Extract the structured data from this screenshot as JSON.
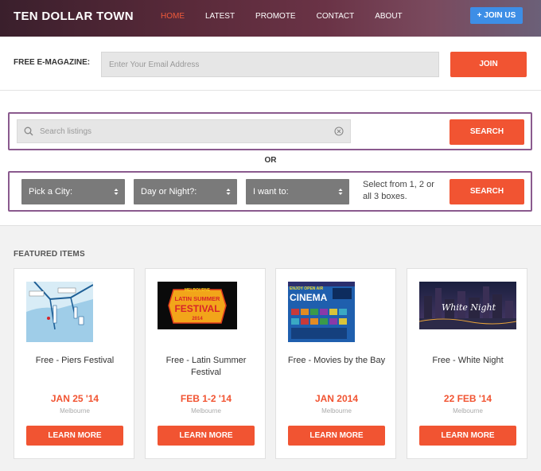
{
  "header": {
    "logo": "TEN DOLLAR TOWN",
    "nav": [
      {
        "label": "HOME",
        "active": true
      },
      {
        "label": "LATEST",
        "active": false
      },
      {
        "label": "PROMOTE",
        "active": false
      },
      {
        "label": "CONTACT",
        "active": false
      },
      {
        "label": "ABOUT",
        "active": false
      }
    ],
    "join_us": "+ JOIN US"
  },
  "emagazine": {
    "label": "FREE E-MAGAZINE:",
    "placeholder": "Enter Your Email Address",
    "value": "",
    "button": "JOIN"
  },
  "search": {
    "placeholder": "Search listings",
    "value": "",
    "button": "SEARCH",
    "search_icon": "search-icon",
    "clear_icon": "clear-icon"
  },
  "or_label": "OR",
  "filters": {
    "selects": [
      {
        "value": "Pick a City:"
      },
      {
        "value": "Day or Night?:"
      },
      {
        "value": "I want to:"
      }
    ],
    "hint": "Select from 1, 2 or all 3 boxes.",
    "button": "SEARCH"
  },
  "featured": {
    "title": "FEATURED ITEMS",
    "items": [
      {
        "title": "Free - Piers Festival",
        "date": "JAN 25 '14",
        "location": "Melbourne",
        "button": "LEARN MORE"
      },
      {
        "title": "Free - Latin Summer Festival",
        "date": "FEB 1-2 '14",
        "location": "Melbourne",
        "button": "LEARN MORE",
        "image_text": {
          "top": "MELBOURNE",
          "line1": "LATIN SUMMER",
          "line2": "FESTIVAL",
          "year": "2014"
        }
      },
      {
        "title": "Free - Movies by the Bay",
        "date": "JAN 2014",
        "location": "Melbourne",
        "button": "LEARN MORE",
        "image_text": {
          "top": "ENJOY OPEN AIR",
          "main": "CINEMA"
        }
      },
      {
        "title": "Free - White Night",
        "date": "22 FEB '14",
        "location": "Melbourne",
        "button": "LEARN MORE",
        "image_text": {
          "main": "White Night"
        }
      }
    ]
  },
  "colors": {
    "accent": "#f15432",
    "join_blue": "#3d8ee6",
    "box_border": "#8a5a8e",
    "select_bg": "#7a7a7a"
  }
}
